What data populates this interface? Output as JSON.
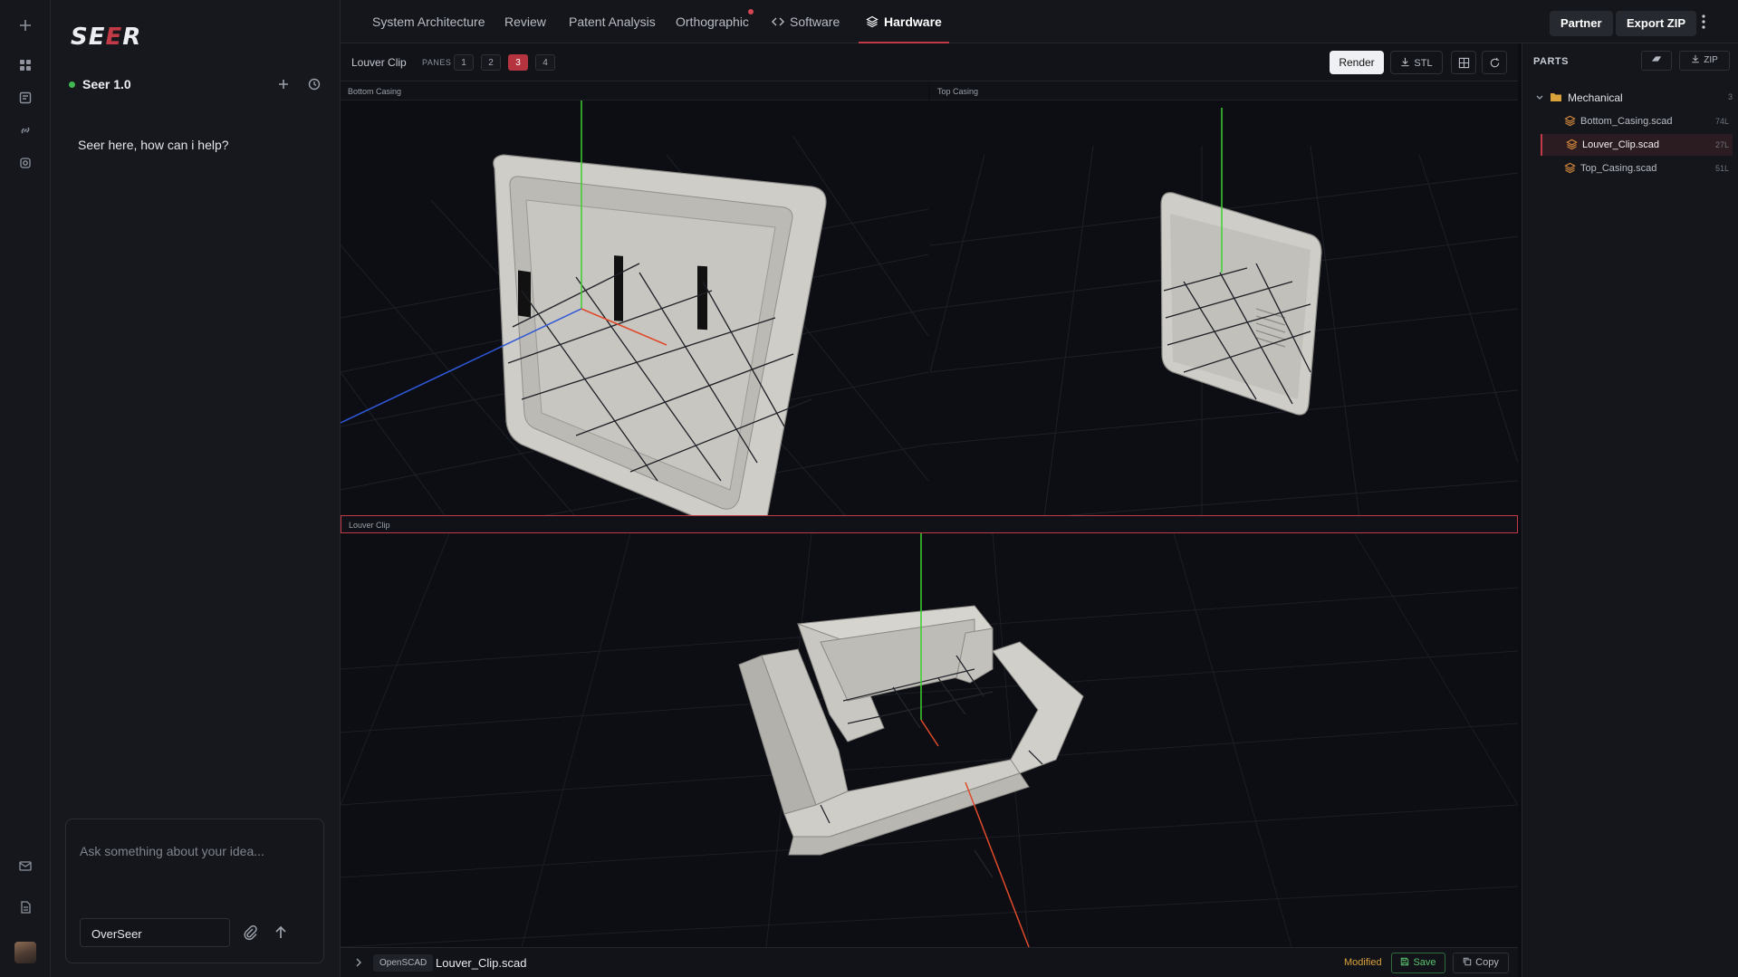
{
  "app": {
    "logo_text_pre": "SE",
    "logo_text_accent": "E",
    "logo_text_post": "R"
  },
  "chat": {
    "model_name": "Seer 1.0",
    "greeting": "Seer here, how can i help?",
    "input_placeholder": "Ask something about your idea...",
    "mode_value": "OverSeer"
  },
  "nav": {
    "tabs": [
      {
        "label": "System Architecture"
      },
      {
        "label": "Review"
      },
      {
        "label": "Patent Analysis"
      },
      {
        "label": "Orthographic"
      },
      {
        "label": "Software"
      },
      {
        "label": "Hardware"
      }
    ],
    "partner_label": "Partner",
    "export_label": "Export ZIP"
  },
  "toolbar": {
    "title": "Louver Clip",
    "panes_label": "PANES",
    "pane_options": [
      "1",
      "2",
      "3",
      "4"
    ],
    "selected_pane": "3",
    "render_label": "Render",
    "stl_label": "STL"
  },
  "panes": [
    {
      "title": "Bottom Casing"
    },
    {
      "title": "Top Casing"
    },
    {
      "title": "Louver Clip"
    }
  ],
  "status": {
    "language": "OpenSCAD",
    "file": "Louver_Clip.scad",
    "state": "Modified",
    "save_label": "Save",
    "copy_label": "Copy"
  },
  "parts": {
    "title": "PARTS",
    "zip_label": "ZIP",
    "folder": {
      "name": "Mechanical",
      "count": "3"
    },
    "files": [
      {
        "name": "Bottom_Casing.scad",
        "lines": "74L",
        "selected": false
      },
      {
        "name": "Louver_Clip.scad",
        "lines": "27L",
        "selected": true
      },
      {
        "name": "Top_Casing.scad",
        "lines": "51L",
        "selected": false
      }
    ]
  },
  "colors": {
    "accent": "#c23a45",
    "axis_x": "#e04a2a",
    "axis_y": "#3ccf2f",
    "axis_z": "#2f57d6",
    "model": "#cfcdc8"
  }
}
